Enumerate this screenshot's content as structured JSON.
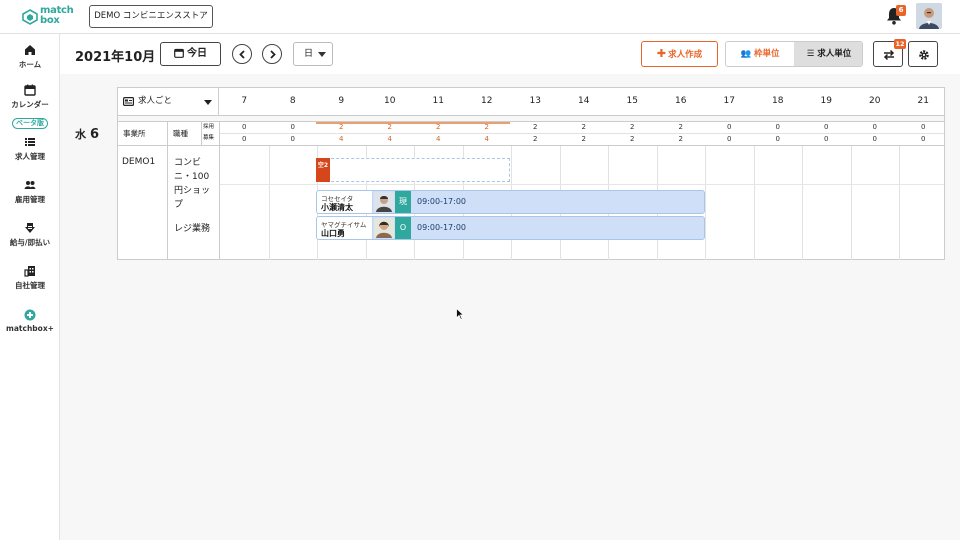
{
  "header": {
    "logo_text": "match box",
    "store_name": "DEMO コンビニエンスストア",
    "notification_count": "6"
  },
  "sidebar": {
    "items": [
      {
        "label": "ホーム",
        "icon": "home-icon"
      },
      {
        "label": "カレンダー",
        "icon": "calendar-icon",
        "badge": "ベータ版"
      },
      {
        "label": "求人管理",
        "icon": "list-icon"
      },
      {
        "label": "雇用管理",
        "icon": "users-icon"
      },
      {
        "label": "給与/即払い",
        "icon": "pay-icon"
      },
      {
        "label": "自社管理",
        "icon": "building-icon"
      },
      {
        "label": "matchbox+",
        "icon": "plus-circle-icon"
      }
    ]
  },
  "toolbar": {
    "month": "2021年10月",
    "today_label": "今日",
    "view_mode": "日",
    "create_label": "求人作成",
    "toggle_left": "枠単位",
    "toggle_right": "求人単位",
    "swap_badge": "12"
  },
  "day": {
    "weekday": "水",
    "date": "6"
  },
  "grid": {
    "filter_label": "求人ごと",
    "hours": [
      "7",
      "8",
      "9",
      "10",
      "11",
      "12",
      "13",
      "14",
      "15",
      "16",
      "17",
      "18",
      "19",
      "20",
      "21"
    ],
    "col_office": "事業所",
    "col_occupation": "職種",
    "row_hired": "採用",
    "row_recruit": "募集",
    "hired": [
      "0",
      "0",
      "2",
      "2",
      "2",
      "2",
      "2",
      "2",
      "2",
      "2",
      "0",
      "0",
      "0",
      "0",
      "0"
    ],
    "recruit": [
      "0",
      "0",
      "4",
      "4",
      "4",
      "4",
      "2",
      "2",
      "2",
      "2",
      "0",
      "0",
      "0",
      "0",
      "0"
    ],
    "office_name": "DEMO1",
    "occupation": "コンビニ・100円ショップ",
    "task": "レジ業務",
    "open_badge": "空2"
  },
  "shifts": [
    {
      "kana": "コセセイタ",
      "name": "小瀬清太",
      "tag": "現",
      "time": "09:00-17:00"
    },
    {
      "kana": "ヤマグチイサム",
      "name": "山口勇",
      "tag": "O",
      "time": "09:00-17:00"
    }
  ],
  "colors": {
    "accent": "#e8652a",
    "brand": "#2fa89d",
    "shift_fill": "#cfdff7"
  }
}
